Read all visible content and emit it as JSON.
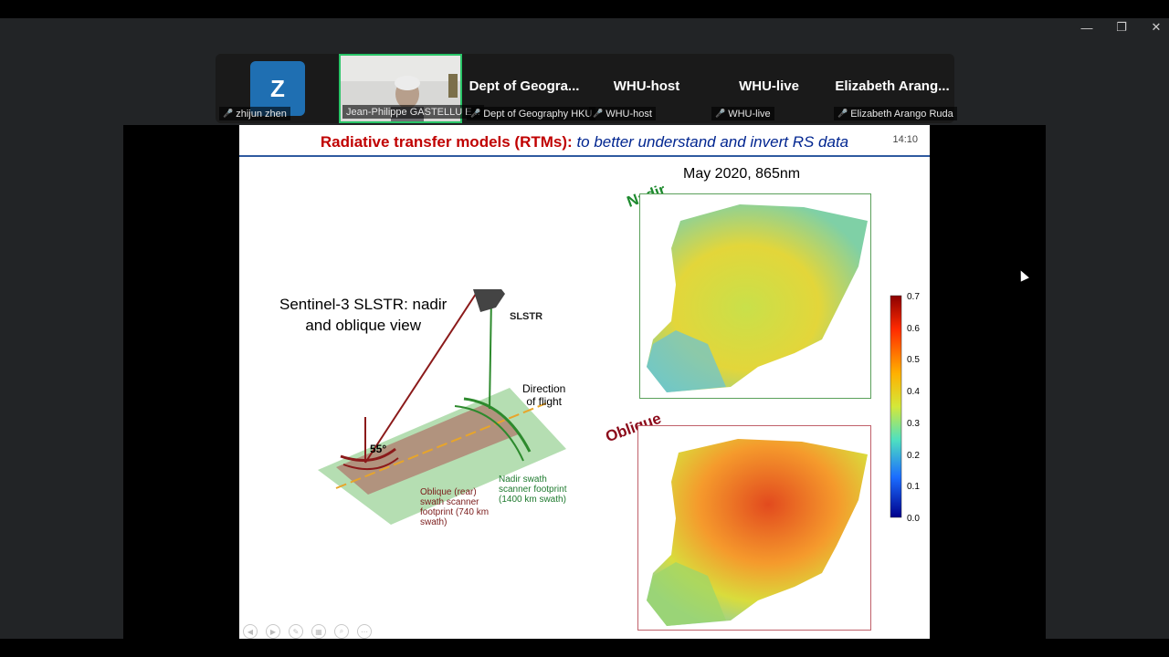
{
  "window": {
    "minimize_icon": "minimize-icon",
    "restore_icon": "restore-icon",
    "close_icon": "close-icon",
    "min_glyph": "—",
    "restore_glyph": "❐",
    "close_glyph": "✕"
  },
  "participants": [
    {
      "avatar_letter": "Z",
      "label": "zhijun zhen",
      "muted": true
    },
    {
      "label": "Jean-Philippe GASTELLU E...",
      "active_speaker": true,
      "muted": false
    },
    {
      "display_name": "Dept of Geogra...",
      "label": "Dept of Geography HKU",
      "muted": true
    },
    {
      "display_name": "WHU-host",
      "label": "WHU-host",
      "muted": true
    },
    {
      "display_name": "WHU-live",
      "label": "WHU-live",
      "muted": true
    },
    {
      "display_name": "Elizabeth  Arang...",
      "label": "Elizabeth Arango Ruda",
      "muted": true
    }
  ],
  "slide": {
    "title_main": "Radiative transfer models (RTMs)",
    "title_sep": ": ",
    "title_sub": "to better understand and invert RS data",
    "time": "14:10",
    "map_title": "May 2020, 865nm",
    "nadir_label": "Nadir",
    "oblique_label": "Oblique",
    "sentinel_line1": "Sentinel-3 SLSTR: nadir",
    "sentinel_line2": "and oblique view",
    "slstr_label": "SLSTR",
    "direction_line1": "Direction",
    "direction_line2": "of flight",
    "angle_label": "55°",
    "oblique_note": [
      "Oblique (rear)",
      "swath scanner",
      "footprint (740 km",
      "swath)"
    ],
    "nadir_note": [
      "Nadir swath",
      "scanner footprint",
      "(1400 km swath)"
    ],
    "colorbar_ticks": [
      "0.7",
      "0.6",
      "0.5",
      "0.4",
      "0.3",
      "0.2",
      "0.1",
      "0.0"
    ],
    "nav_icons": [
      "prev-icon",
      "next-icon",
      "pen-icon",
      "slides-icon",
      "zoom-icon",
      "more-icon"
    ]
  },
  "colors": {
    "active_border": "#29c467",
    "title_red": "#c00000",
    "title_blue": "#002590",
    "nadir_green": "#1e8a2e",
    "oblique_red": "#8b0a1a"
  }
}
